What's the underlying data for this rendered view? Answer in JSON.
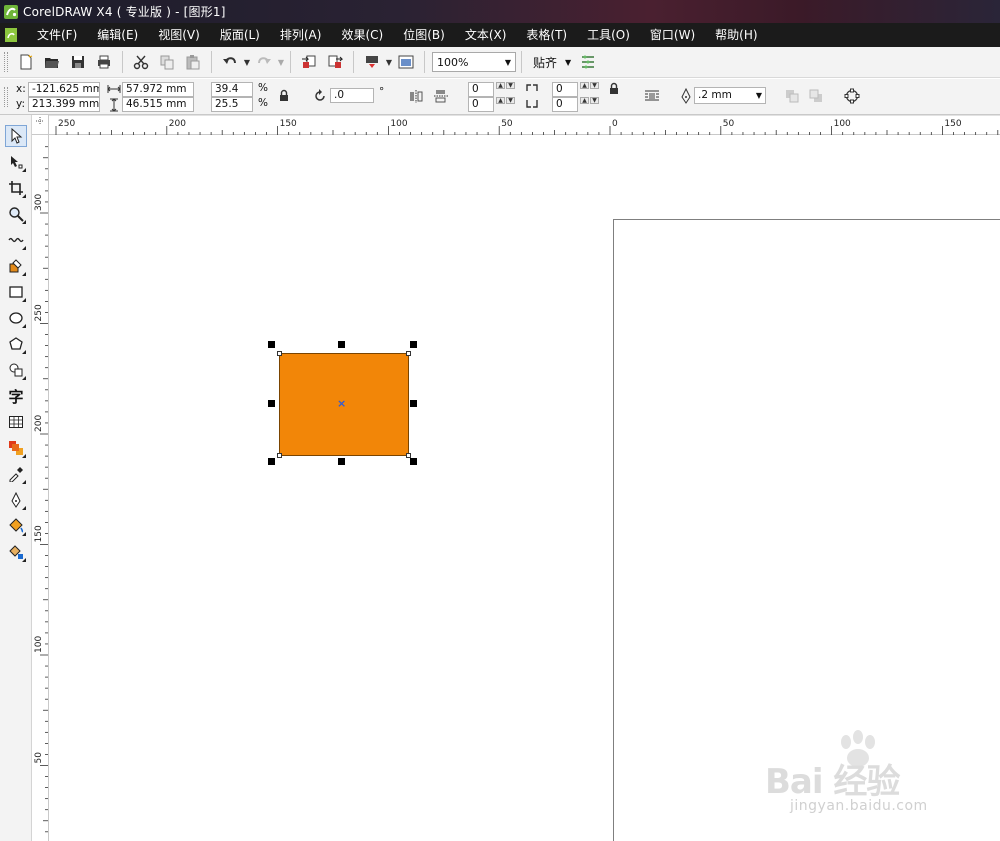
{
  "window": {
    "title": "CorelDRAW X4 ( 专业版 ) - [图形1]"
  },
  "menu": {
    "items": [
      "文件(F)",
      "编辑(E)",
      "视图(V)",
      "版面(L)",
      "排列(A)",
      "效果(C)",
      "位图(B)",
      "文本(X)",
      "表格(T)",
      "工具(O)",
      "窗口(W)",
      "帮助(H)"
    ]
  },
  "toolbar": {
    "zoom_value": "100%",
    "snap_label": "贴齐"
  },
  "property_bar": {
    "x_label": "x:",
    "x_value": "-121.625 mm",
    "y_label": "y:",
    "y_value": "213.399 mm",
    "width_value": "57.972 mm",
    "height_value": "46.515 mm",
    "scale_w": "39.4",
    "scale_h": "25.5",
    "percent": "%",
    "rotation_value": ".0",
    "degree": "°",
    "corner_tl": "0",
    "corner_bl": "0",
    "corner_tr": "0",
    "corner_br": "0",
    "outline_width": ".2 mm"
  },
  "rulers": {
    "horizontal": [
      "250",
      "200",
      "150",
      "100",
      "50",
      "0",
      "50",
      "100",
      "150"
    ],
    "vertical": [
      "300",
      "250",
      "200",
      "150",
      "100",
      "50"
    ]
  },
  "toolbox": {
    "tools": [
      "pick-tool",
      "shape-tool",
      "crop-tool",
      "zoom-tool",
      "freehand-tool",
      "smart-fill-tool",
      "rectangle-tool",
      "ellipse-tool",
      "polygon-tool",
      "basic-shapes-tool",
      "text-tool",
      "table-tool",
      "interactive-blend-tool",
      "eyedropper-tool",
      "outline-tool",
      "fill-tool",
      "interactive-fill-tool"
    ],
    "text_tool_glyph": "字"
  },
  "canvas": {
    "rect_fill": "#f28608",
    "rect_outline": "#7a4400"
  },
  "watermark": {
    "main": "Bai 经验",
    "sub": "jingyan.baidu.com"
  }
}
